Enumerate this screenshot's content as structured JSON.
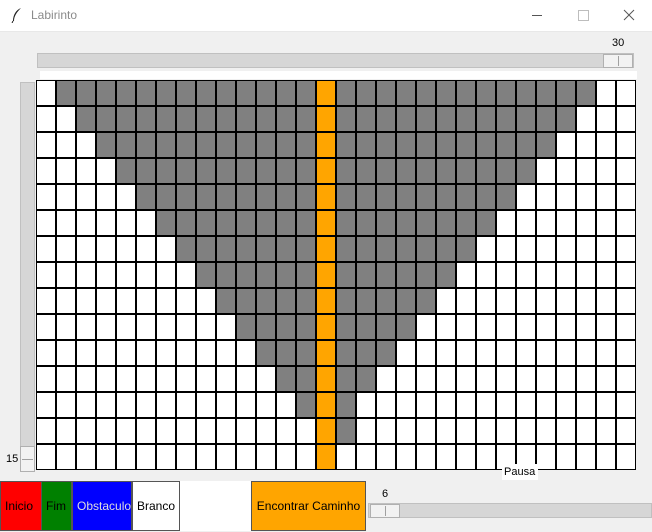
{
  "window": {
    "title": "Labirinto"
  },
  "width_scale": {
    "value": "30",
    "level": 30
  },
  "height_scale": {
    "value": "15",
    "level": 15
  },
  "maze": {
    "columns": 30,
    "rows": 15,
    "colors": {
      "empty": "#ffffff",
      "obstacle": "#808080",
      "path": "#ffa500",
      "grid_line": "#000000"
    },
    "path_column": 14,
    "obstacle_ranges": [
      [
        1,
        27
      ],
      [
        2,
        26
      ],
      [
        3,
        25
      ],
      [
        4,
        24
      ],
      [
        5,
        23
      ],
      [
        6,
        22
      ],
      [
        7,
        21
      ],
      [
        8,
        20
      ],
      [
        9,
        19
      ],
      [
        10,
        18
      ],
      [
        11,
        17
      ],
      [
        12,
        16
      ],
      [
        13,
        15
      ],
      [
        14,
        15
      ],
      [
        null,
        null
      ]
    ]
  },
  "pause_label": "Pausa",
  "buttons": {
    "inicio": "Inicio",
    "fim": "Fim",
    "obstaculo": "Obstaculo",
    "branco": "Branco",
    "encontrar": "Encontrar Caminho"
  },
  "speed_scale": {
    "value": "6",
    "level": 6
  },
  "icons": {
    "app": "feather-icon",
    "minimize": "minimize-icon",
    "maximize": "maximize-icon",
    "close": "close-icon"
  }
}
